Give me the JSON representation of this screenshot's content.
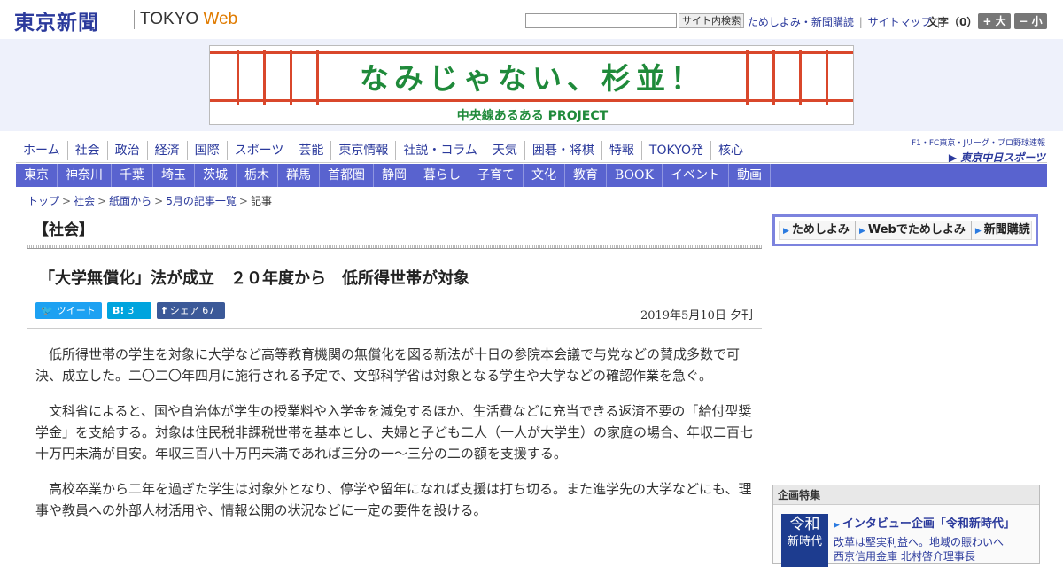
{
  "header": {
    "logo_jp": "東京新聞",
    "logo_en_tokyo": "TOKYO",
    "logo_en_web": "Web",
    "search_placeholder": "",
    "search_button": "サイト内検索",
    "links": [
      "ためしよみ・新聞購読",
      "サイトマップ"
    ],
    "font_label": "文字（0）",
    "font_up": "+ 大",
    "font_down": "− 小"
  },
  "banner": {
    "title": "なみじゃない、杉並！",
    "subtitle": "中央線あるある PROJECT"
  },
  "nav_primary": [
    "ホーム",
    "社会",
    "政治",
    "経済",
    "国際",
    "スポーツ",
    "芸能",
    "東京情報",
    "社説・コラム",
    "天気",
    "囲碁・将棋",
    "特報",
    "TOKYO発",
    "核心"
  ],
  "sports_link": {
    "line1": "F1・FC東京・Jリーグ・プロ野球速報",
    "line2": "▶ 東京中日スポーツ"
  },
  "nav_secondary": [
    "東京",
    "神奈川",
    "千葉",
    "埼玉",
    "茨城",
    "栃木",
    "群馬",
    "首都圏",
    "静岡",
    "暮らし",
    "子育て",
    "文化",
    "教育",
    "BOOK",
    "イベント",
    "動画"
  ],
  "breadcrumb": {
    "items": [
      "トップ",
      "社会",
      "紙面から",
      "5月の記事一覧"
    ],
    "current": "記事",
    "separator": ">"
  },
  "section_label": "【社会】",
  "article": {
    "headline": "「大学無償化」法が成立　２０年度から　低所得世帯が対象",
    "date": "2019年5月10日 夕刊",
    "paragraphs": [
      "低所得世帯の学生を対象に大学など高等教育機関の無償化を図る新法が十日の参院本会議で与党などの賛成多数で可決、成立した。二〇二〇年四月に施行される予定で、文部科学省は対象となる学生や大学などの確認作業を急ぐ。",
      "文科省によると、国や自治体が学生の授業料や入学金を減免するほか、生活費などに充当できる返済不要の「給付型奨学金」を支給する。対象は住民税非課税世帯を基本とし、夫婦と子ども二人（一人が大学生）の家庭の場合、年収二百七十万円未満が目安。年収三百八十万円未満であれば三分の一～三分の二の額を支援する。",
      "高校卒業から二年を過ぎた学生は対象外となり、停学や留年になれば支援は打ち切る。また進学先の大学などにも、理事や教員への外部人材活用や、情報公開の状況などに一定の要件を設ける。"
    ]
  },
  "share": {
    "tweet": "ツイート",
    "hatena_icon": "B!",
    "hatena_count": "3",
    "fb_icon": "f",
    "fb_label": "シェア",
    "fb_count": "67"
  },
  "promo": [
    "ためしよみ",
    "Webでためしよみ",
    "新聞購読"
  ],
  "feature": {
    "heading": "企画特集",
    "thumb_line1": "令和",
    "thumb_line2": "新時代",
    "title": "インタビュー企画「令和新時代」",
    "sub_line1": "改革は堅実利益へ。地域の賑わいへ",
    "sub_line2": "西京信用金庫 北村啓介理事長"
  },
  "colors": {
    "brand_blue": "#2b3a9c",
    "nav_bar": "#5963cf",
    "banner_green": "#1f8a3a",
    "banner_red": "#d9472b",
    "web_orange": "#e07b00"
  }
}
